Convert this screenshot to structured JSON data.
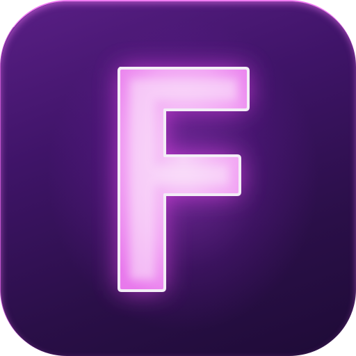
{
  "icon": {
    "letter": "F",
    "colors": {
      "background_top": "#5a1f86",
      "background_bottom": "#1e0b36",
      "rim": "#f07cf2",
      "glyph_fill": "#f6c6f7",
      "glyph_edge": "#f2f0f4",
      "glow": "#e44de8"
    }
  }
}
